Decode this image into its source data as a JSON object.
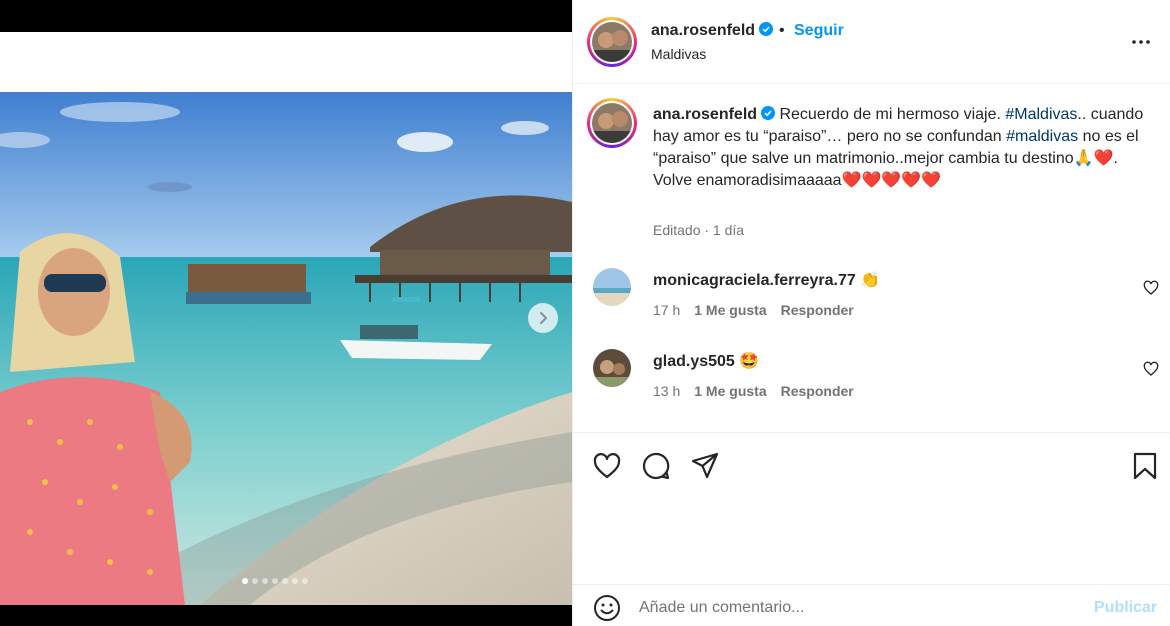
{
  "post": {
    "username": "ana.rosenfeld",
    "follow_label": "Seguir",
    "separator": "•",
    "location": "Maldivas",
    "more_icon": "more-horizontal-icon",
    "media": {
      "slides": 7,
      "active_slide": 1
    }
  },
  "caption": {
    "username": "ana.rosenfeld",
    "text_1": " Recuerdo de mi hermoso viaje. ",
    "tag_1": "#Maldivas",
    "text_2": ".. cuando hay amor es tu “paraiso”… pero no se confundan ",
    "tag_2": "#maldivas",
    "text_3": " no es el “paraiso” que salve un matrimonio..mejor cambia tu destino",
    "emoji_1": "🙏❤️",
    "text_4": ". Volve enamoradisimaaaaa",
    "emoji_2": "❤️❤️❤️❤️❤️",
    "meta": "Editado · 1 día"
  },
  "comments": [
    {
      "username": "monicagraciela.ferreyra.77",
      "emoji": "👏",
      "time": "17 h",
      "likes": "1 Me gusta",
      "reply": "Responder"
    },
    {
      "username": "glad.ys505",
      "emoji": "🤩",
      "time": "13 h",
      "likes": "1 Me gusta",
      "reply": "Responder"
    }
  ],
  "compose": {
    "placeholder": "Añade un comentario...",
    "publish_label": "Publicar"
  },
  "colors": {
    "accent": "#0095f6",
    "publish_disabled": "#b2dffc",
    "hashtag": "#00376b"
  }
}
